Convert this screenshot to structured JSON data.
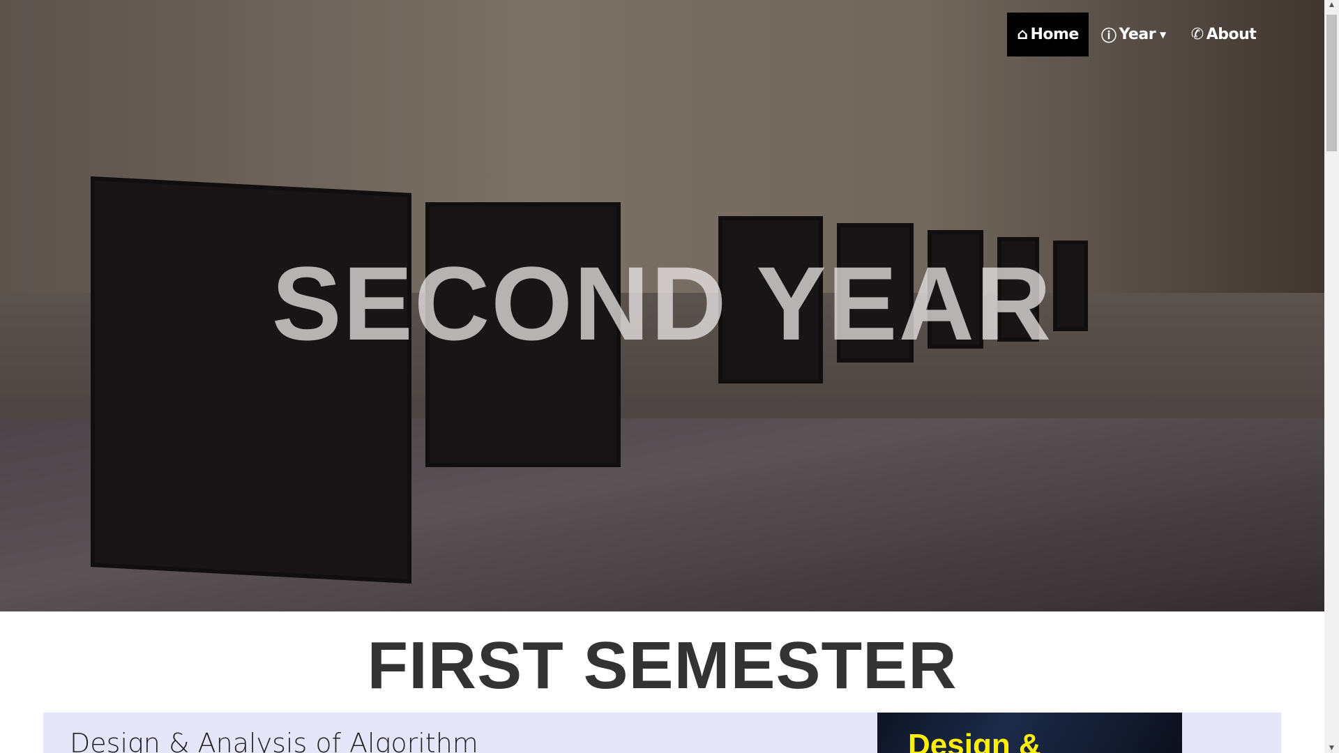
{
  "nav": {
    "items": [
      {
        "label": "Home",
        "icon": "home-icon",
        "active": true
      },
      {
        "label": "Year",
        "icon": "info-circle-icon",
        "dropdown": true
      },
      {
        "label": "About",
        "icon": "phone-icon"
      }
    ]
  },
  "hero": {
    "title": "SECOND YEAR"
  },
  "section": {
    "title": "FIRST SEMESTER"
  },
  "subjects": [
    {
      "title": "Design & Analysis of Algorithm",
      "cover_text": "Design &"
    }
  ],
  "colors": {
    "card_bg": "#e6e6fa",
    "nav_active_bg": "#000000",
    "cover_text": "#ffef00"
  }
}
